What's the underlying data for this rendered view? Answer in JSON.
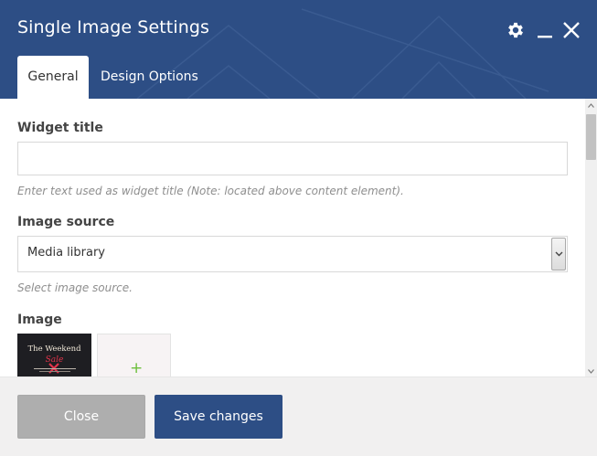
{
  "window": {
    "title": "Single Image Settings",
    "icons": [
      "gear-icon",
      "minimize-icon",
      "close-icon"
    ]
  },
  "tabs": [
    {
      "label": "General",
      "active": true
    },
    {
      "label": "Design Options",
      "active": false
    }
  ],
  "fields": {
    "widget_title": {
      "label": "Widget title",
      "value": "",
      "help": "Enter text used as widget title (Note: located above content element)."
    },
    "image_source": {
      "label": "Image source",
      "selected": "Media library",
      "help": "Select image source."
    },
    "image": {
      "label": "Image",
      "thumbnail": {
        "line1": "The Weekend",
        "line2": "Sale"
      },
      "add_icon": "plus-icon"
    }
  },
  "footer": {
    "close_label": "Close",
    "save_label": "Save changes"
  },
  "colors": {
    "header": "#2d4e85",
    "save_button": "#2d4e85",
    "close_button": "#aeaeae",
    "add_plus": "#6cbf3b",
    "thumbnail_accent": "#e2334a"
  }
}
